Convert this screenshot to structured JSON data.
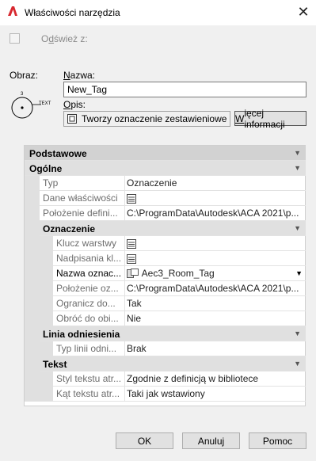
{
  "window": {
    "title": "Właściwości narzędzia",
    "close_glyph": "✕",
    "app_icon": "autocad-a-icon"
  },
  "refresh": {
    "label_u": "d",
    "label_pre": "O",
    "label_post": "śwież z:",
    "checked": false
  },
  "image": {
    "label": "Obraz:",
    "tag_caption": "TEXT",
    "tag_number": "3"
  },
  "name": {
    "label_u": "N",
    "label_rest": "azwa:",
    "value": "New_Tag"
  },
  "description": {
    "label_u": "O",
    "label_rest": "pis:",
    "value": "Tworzy oznaczenie zestawieniowe"
  },
  "more_info_button": {
    "label_u": "W",
    "label_rest": "ięcej informacji"
  },
  "grid": {
    "sections": {
      "basic": "Podstawowe",
      "general": "Ogólne",
      "tag": "Oznaczenie",
      "leader": "Linia odniesienia",
      "text": "Tekst"
    },
    "general": [
      {
        "name": "Typ",
        "value": "Oznaczenie"
      },
      {
        "name": "Dane właściwości",
        "value": ""
      },
      {
        "name": "Położenie defini...",
        "value": "C:\\ProgramData\\Autodesk\\ACA  2021\\p..."
      }
    ],
    "tag": [
      {
        "name": "Klucz warstwy",
        "value": ""
      },
      {
        "name": "Nadpisania kl...",
        "value": ""
      },
      {
        "name": "Nazwa oznac...",
        "value": "Aec3_Room_Tag"
      },
      {
        "name": "Położenie oz...",
        "value": "C:\\ProgramData\\Autodesk\\ACA  2021\\p..."
      },
      {
        "name": "Ogranicz do...",
        "value": "Tak"
      },
      {
        "name": "Obróć do obi...",
        "value": "Nie"
      }
    ],
    "leader": [
      {
        "name": "Typ linii odni...",
        "value": "Brak"
      }
    ],
    "text": [
      {
        "name": "Styl tekstu atr...",
        "value": "Zgodnie z definicją w bibliotece"
      },
      {
        "name": "Kąt tekstu atr...",
        "value": "Taki jak wstawiony"
      }
    ]
  },
  "buttons": {
    "ok": "OK",
    "cancel": "Anuluj",
    "help": "Pomoc"
  }
}
